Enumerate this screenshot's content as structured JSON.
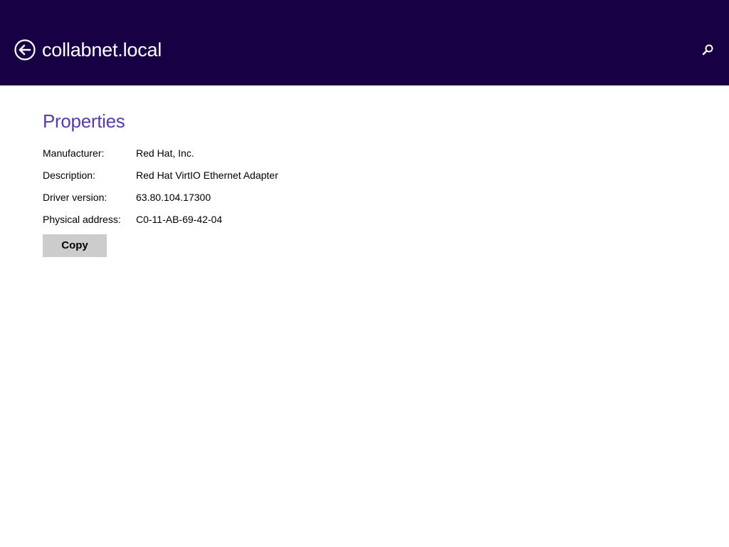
{
  "header": {
    "title": "collabnet.local",
    "back_icon": "back-arrow-circle-icon",
    "search_icon": "search-icon",
    "background_color": "#180044"
  },
  "properties": {
    "title": "Properties",
    "title_color": "#5a3aa6",
    "rows": [
      {
        "label": "Manufacturer:",
        "value": "Red Hat, Inc."
      },
      {
        "label": "Description:",
        "value": "Red Hat VirtIO Ethernet Adapter"
      },
      {
        "label": "Driver version:",
        "value": "63.80.104.17300"
      },
      {
        "label": "Physical address:",
        "value": "C0-11-AB-69-42-04"
      }
    ],
    "copy_label": "Copy"
  }
}
